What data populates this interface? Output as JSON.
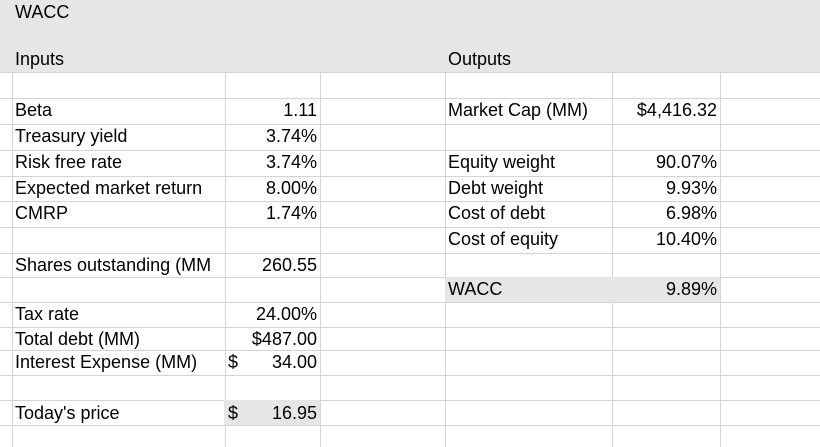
{
  "sheet": {
    "title": "WACC",
    "inputs_header": "Inputs",
    "outputs_header": "Outputs",
    "inputs": [
      {
        "label": "Beta",
        "value": "1.11"
      },
      {
        "label": "Treasury yield",
        "value": "3.74%"
      },
      {
        "label": "Risk free rate",
        "value": "3.74%"
      },
      {
        "label": "Expected market return",
        "value": "8.00%"
      },
      {
        "label": "CMRP",
        "value": "1.74%"
      },
      {
        "label": "Shares outstanding (MM",
        "value": "260.55"
      },
      {
        "label": "Tax rate",
        "value": "24.00%"
      },
      {
        "label": "Total debt (MM)",
        "value": "$487.00"
      },
      {
        "label": "Interest Expense (MM)",
        "currency": "$",
        "value": "34.00"
      },
      {
        "label": "Today's price",
        "currency": "$",
        "value": "16.95"
      }
    ],
    "outputs": [
      {
        "label": "Market Cap (MM)",
        "value": "$4,416.32"
      },
      {
        "label": "Equity weight",
        "value": "90.07%"
      },
      {
        "label": "Debt weight",
        "value": "9.93%"
      },
      {
        "label": "Cost of debt",
        "value": "6.98%"
      },
      {
        "label": "Cost of equity",
        "value": "10.40%"
      },
      {
        "label": "WACC",
        "value": "9.89%"
      }
    ]
  },
  "colors": {
    "gridline": "#d4d4d4",
    "header_fill": "#e6e6e6",
    "highlight_fill": "#e6e6e6",
    "text": "#000000"
  }
}
